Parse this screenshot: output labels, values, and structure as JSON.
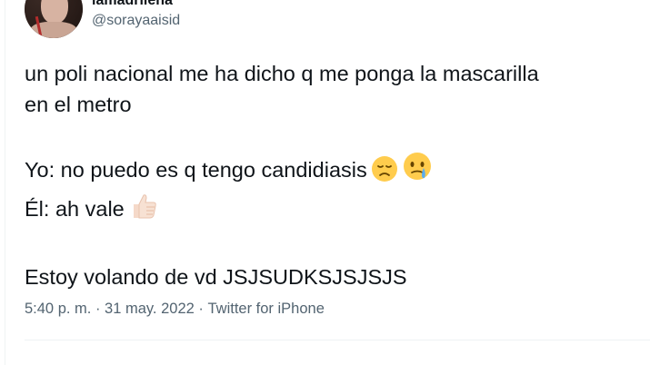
{
  "author": {
    "display_name": "lamadriiena",
    "handle": "@sorayaaisid"
  },
  "tweet": {
    "line1": "un poli nacional me ha dicho q me ponga la mascarilla",
    "line2": "en el metro",
    "line3": "Yo: no puedo es q tengo candidiasis",
    "line4": "Él: ah vale",
    "line5": "Estoy volando de vd JSJSUDKSJSJSJS",
    "emojis": [
      "disappointed-face-icon",
      "face-holding-back-tears-icon",
      "thumbs-up-icon"
    ]
  },
  "meta": {
    "time": "5:40 p. m.",
    "separator": " · ",
    "date": "31 may. 2022",
    "source": "Twitter for iPhone"
  }
}
